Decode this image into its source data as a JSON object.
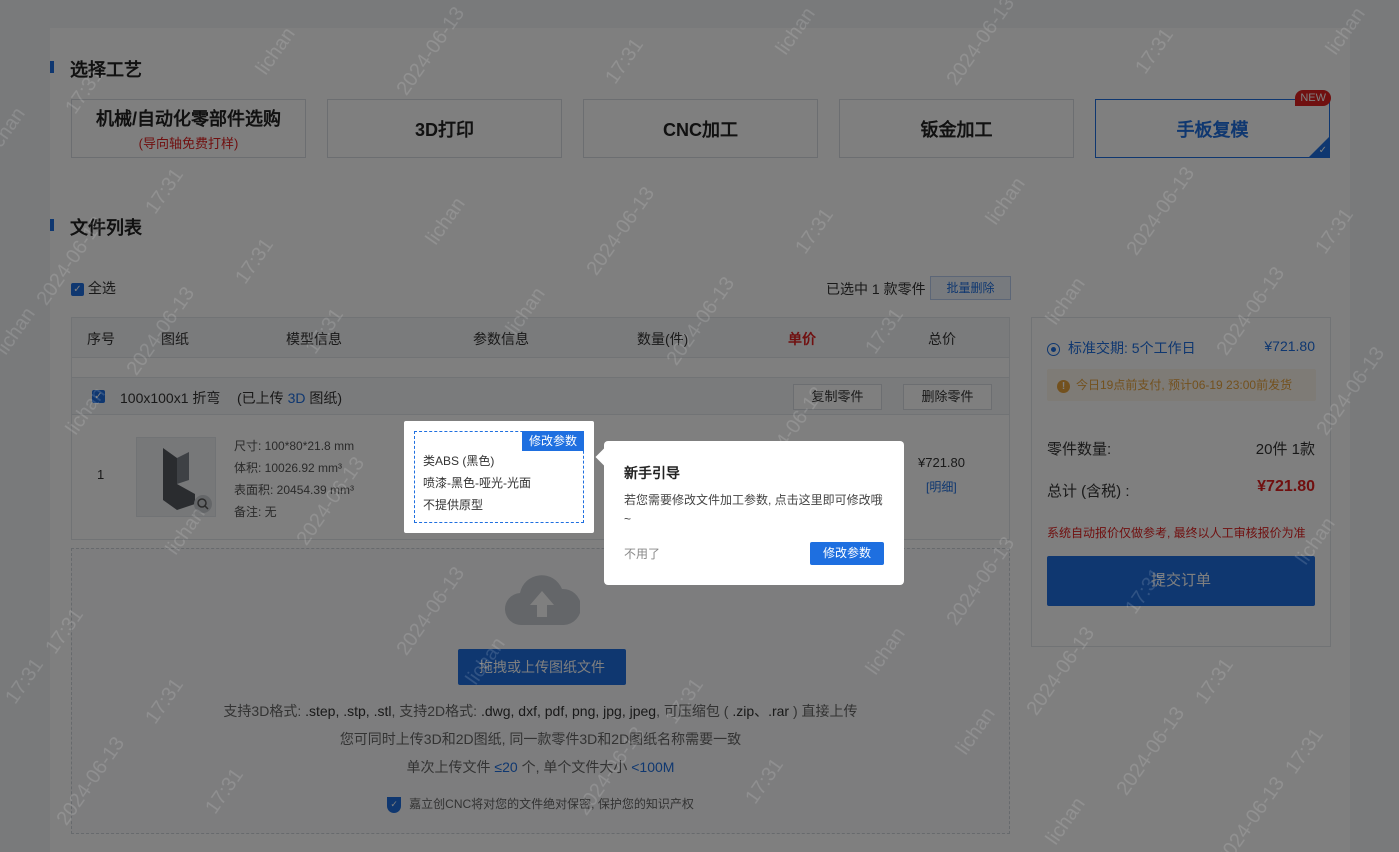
{
  "sections": {
    "craft_title": "选择工艺",
    "files_title": "文件列表"
  },
  "crafts": [
    {
      "label": "机械/自动化零部件选购",
      "sub": "(导向轴免费打样)"
    },
    {
      "label": "3D打印"
    },
    {
      "label": "CNC加工"
    },
    {
      "label": "钣金加工"
    },
    {
      "label": "手板复模",
      "badge": "NEW",
      "active": true
    }
  ],
  "toolbar": {
    "select_all": "全选",
    "selected_prefix": "已选中",
    "selected_count": "1",
    "selected_suffix": "款零件",
    "batch_delete": "批量删除"
  },
  "table": {
    "headers": [
      "序号",
      "图纸",
      "模型信息",
      "参数信息",
      "数量(件)",
      "单价",
      "总价"
    ],
    "group": {
      "name": "100x100x1 折弯",
      "uploaded_prefix": "(已上传",
      "uploaded_type": "3D",
      "uploaded_suffix": "图纸)",
      "copy_btn": "复制零件",
      "delete_btn": "删除零件"
    },
    "row": {
      "index": "1",
      "size": "尺寸: 100*80*21.8 mm",
      "volume": "体积: 10026.92 mm³",
      "area": "表面积: 20454.39 mm³",
      "note": "备注: 无",
      "total": "¥721.80",
      "detail_link": "[明细]"
    }
  },
  "params": {
    "tag": "修改参数",
    "material": "类ABS (黑色)",
    "finish": "喷漆-黑色-哑光-光面",
    "prototype": "不提供原型"
  },
  "upload": {
    "button": "拖拽或上传图纸文件",
    "line1_a": "支持3D格式:",
    "line1_b": ".step, .stp, .stl",
    "line1_c": ", 支持2D格式:",
    "line1_d": ".dwg, dxf, pdf, png, jpg, jpeg",
    "line1_e": ", 可压缩包 (",
    "line1_f": ".zip、.rar",
    "line1_g": ") 直接上传",
    "line2": "您可同时上传3D和2D图纸, 同一款零件3D和2D图纸名称需要一致",
    "line3_a": "单次上传文件",
    "line3_b": "≤20",
    "line3_c": "个, 单个文件大小",
    "line3_d": "<100M",
    "secure": "嘉立创CNC将对您的文件绝对保密, 保护您的知识产权"
  },
  "summary": {
    "delivery": "标准交期: 5个工作日",
    "delivery_price": "¥721.80",
    "warning": "今日19点前支付, 预计06-19 23:00前发货",
    "qty_label": "零件数量:",
    "qty_value": "20件 1款",
    "total_label": "总计 (含税) :",
    "total_value": "¥721.80",
    "disclaimer": "系统自动报价仅做参考, 最终以人工审核报价为准",
    "submit": "提交订单"
  },
  "guide": {
    "title": "新手引导",
    "text": "若您需要修改文件加工参数, 点击这里即可修改哦~",
    "skip": "不用了",
    "action": "修改参数"
  },
  "watermark": {
    "name": "lichan",
    "date": "2024-06-13",
    "time": "17:31"
  },
  "colors": {
    "accent": "#1e6fe0",
    "price_red": "#e02020",
    "warning": "#e6a23c"
  }
}
